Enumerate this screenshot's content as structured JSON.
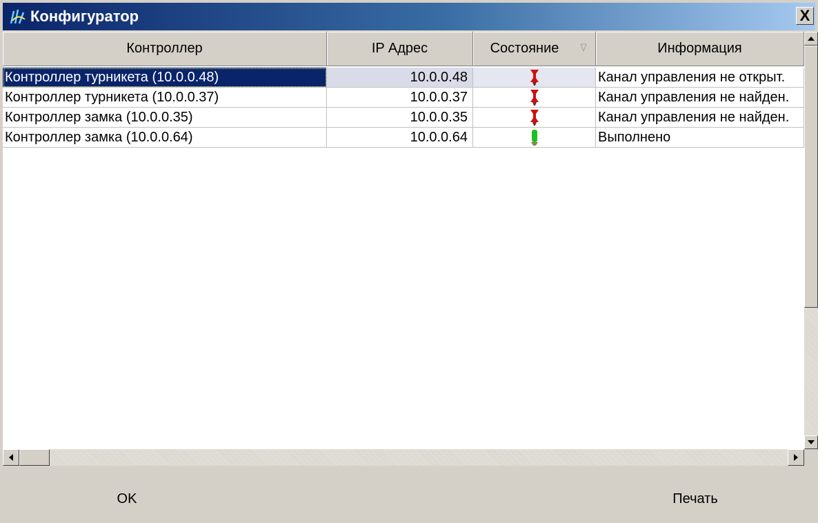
{
  "window": {
    "title": "Конфигуратор",
    "close_label": "X"
  },
  "table": {
    "columns": [
      "Контроллер",
      "IP Адрес",
      "Состояние",
      "Информация"
    ],
    "rows": [
      {
        "controller": "Контроллер турникета (10.0.0.48)",
        "ip": "10.0.0.48",
        "status": "error",
        "info": "Канал управления не открыт.",
        "selected": true
      },
      {
        "controller": "Контроллер  турникета (10.0.0.37)",
        "ip": "10.0.0.37",
        "status": "error",
        "info": "Канал управления не найден.",
        "selected": false
      },
      {
        "controller": "Контроллер замка  (10.0.0.35)",
        "ip": "10.0.0.35",
        "status": "error",
        "info": "Канал управления не найден.",
        "selected": false
      },
      {
        "controller": "Контроллер замка (10.0.0.64)",
        "ip": "10.0.0.64",
        "status": "ok",
        "info": "Выполнено",
        "selected": false
      }
    ]
  },
  "status_icons": {
    "error": "red-pin-icon",
    "ok": "green-pin-icon"
  },
  "colors": {
    "error": "#cc1010",
    "ok": "#1fbf1f",
    "selection": "#0a246a"
  },
  "buttons": {
    "ok_label": "OK",
    "print_label": "Печать"
  }
}
